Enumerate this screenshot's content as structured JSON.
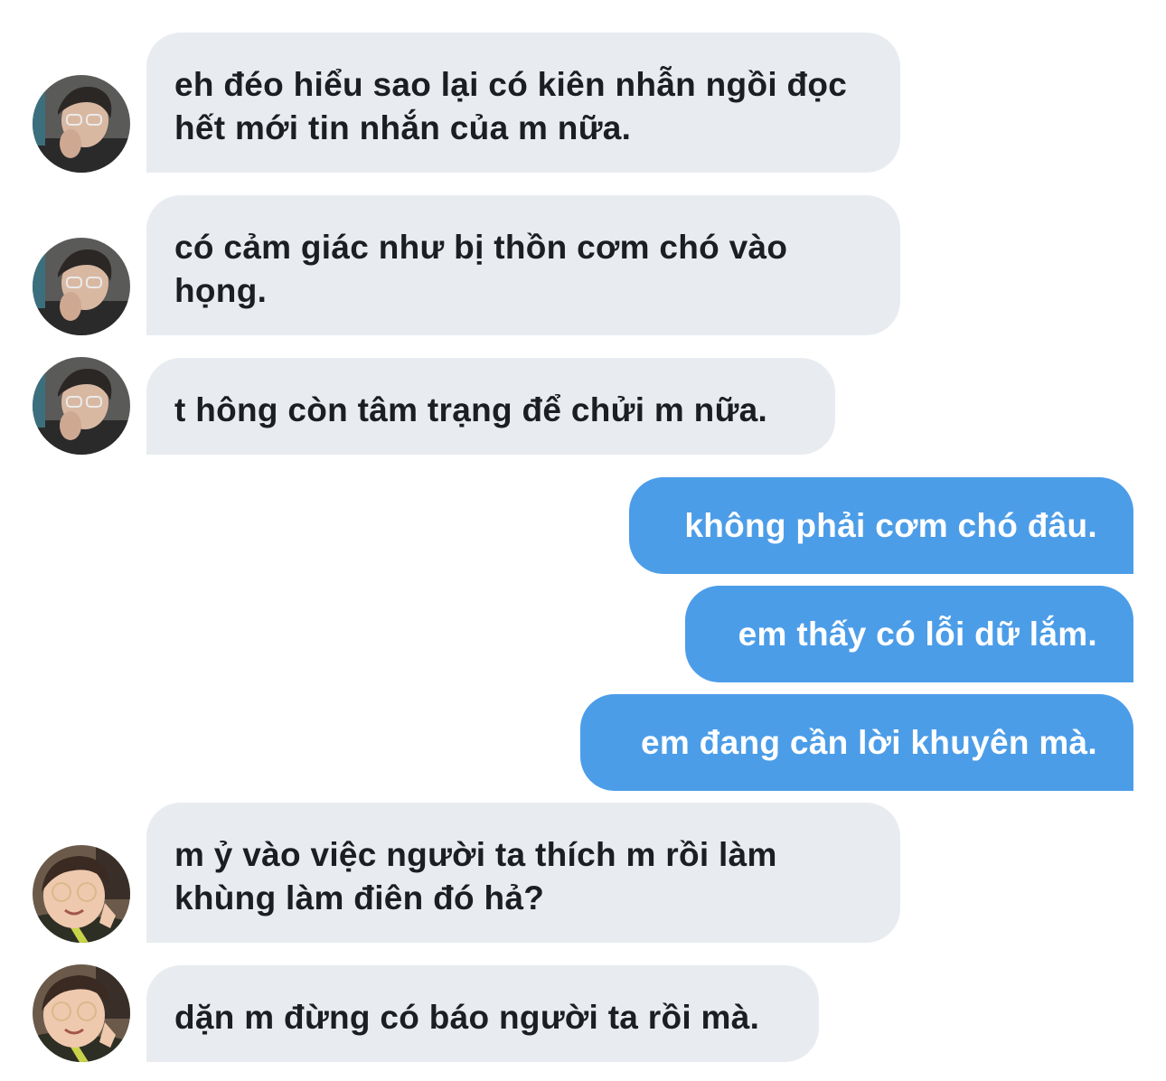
{
  "conversation": {
    "messages": [
      {
        "sender": "them",
        "avatar": "glasses-boy-avatar",
        "text": "eh đéo hiểu sao lại có kiên nhẫn ngồi đọc hết mới tin nhắn của m nữa."
      },
      {
        "sender": "them",
        "avatar": "glasses-boy-avatar",
        "text": "có cảm giác như bị thồn cơm chó vào họng."
      },
      {
        "sender": "them",
        "avatar": "glasses-boy-avatar",
        "text": "t hông còn tâm trạng để chửi m nữa."
      },
      {
        "sender": "me",
        "text": "không phải cơm chó đâu."
      },
      {
        "sender": "me",
        "text": "em thấy có lỗi dữ lắm."
      },
      {
        "sender": "me",
        "text": "em đang cần lời khuyên mà."
      },
      {
        "sender": "them",
        "avatar": "smiling-boy-avatar",
        "text": "m ỷ vào việc người ta thích m rồi làm khùng làm điên đó hả?"
      },
      {
        "sender": "them",
        "avatar": "smiling-boy-avatar",
        "text": "dặn m đừng có báo người ta rồi mà."
      }
    ]
  },
  "colors": {
    "incoming_bubble": "#e8ecf0",
    "outgoing_bubble": "#4c9de8",
    "incoming_text": "#1c1e21",
    "outgoing_text": "#ffffff"
  }
}
